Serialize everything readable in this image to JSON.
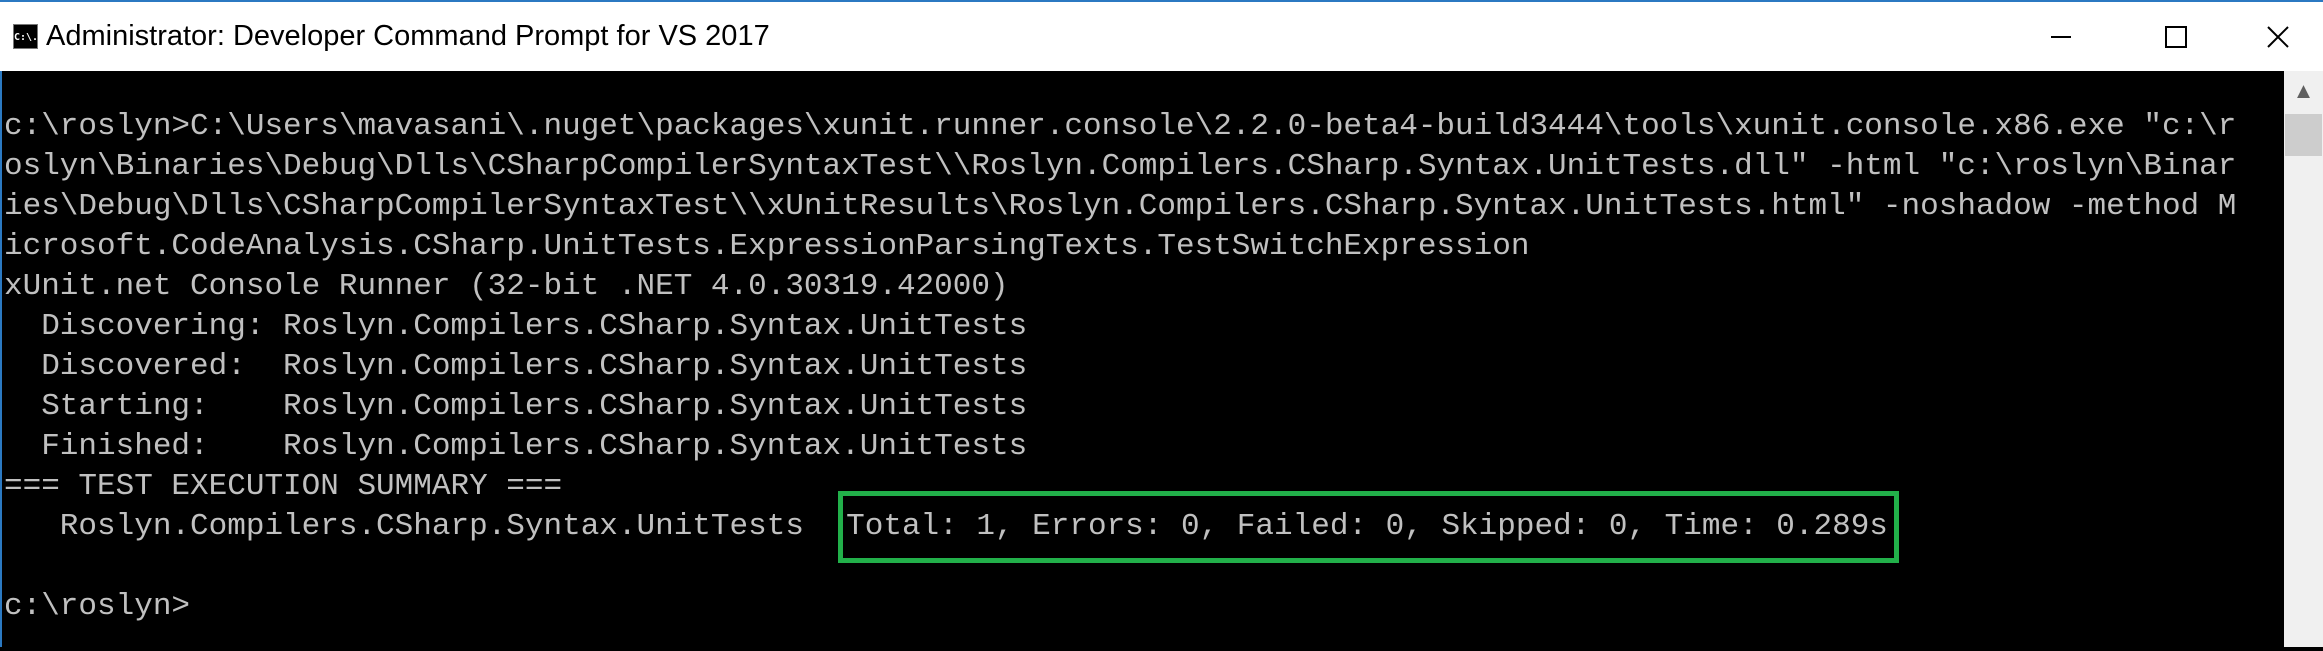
{
  "window": {
    "title": "Administrator: Developer Command Prompt for VS 2017",
    "icon": "console-icon",
    "icon_text": "C:\\."
  },
  "console": {
    "lines": [
      "c:\\roslyn>C:\\Users\\mavasani\\.nuget\\packages\\xunit.runner.console\\2.2.0-beta4-build3444\\tools\\xunit.console.x86.exe \"c:\\r",
      "oslyn\\Binaries\\Debug\\Dlls\\CSharpCompilerSyntaxTest\\\\Roslyn.Compilers.CSharp.Syntax.UnitTests.dll\" -html \"c:\\roslyn\\Binar",
      "ies\\Debug\\Dlls\\CSharpCompilerSyntaxTest\\\\xUnitResults\\Roslyn.Compilers.CSharp.Syntax.UnitTests.html\" -noshadow -method M",
      "icrosoft.CodeAnalysis.CSharp.UnitTests.ExpressionParsingTexts.TestSwitchExpression",
      "xUnit.net Console Runner (32-bit .NET 4.0.30319.42000)",
      "  Discovering: Roslyn.Compilers.CSharp.Syntax.UnitTests",
      "  Discovered:  Roslyn.Compilers.CSharp.Syntax.UnitTests",
      "  Starting:    Roslyn.Compilers.CSharp.Syntax.UnitTests",
      "  Finished:    Roslyn.Compilers.CSharp.Syntax.UnitTests",
      "=== TEST EXECUTION SUMMARY ==="
    ],
    "summary_assembly": "   Roslyn.Compilers.CSharp.Syntax.UnitTests  ",
    "summary_result": "Total: 1, Errors: 0, Failed: 0, Skipped: 0, Time: 0.289s",
    "prompt": "c:\\roslyn>"
  },
  "colors": {
    "text": "#c0c0c0",
    "background": "#000000",
    "highlight_box": "#22b04a"
  }
}
